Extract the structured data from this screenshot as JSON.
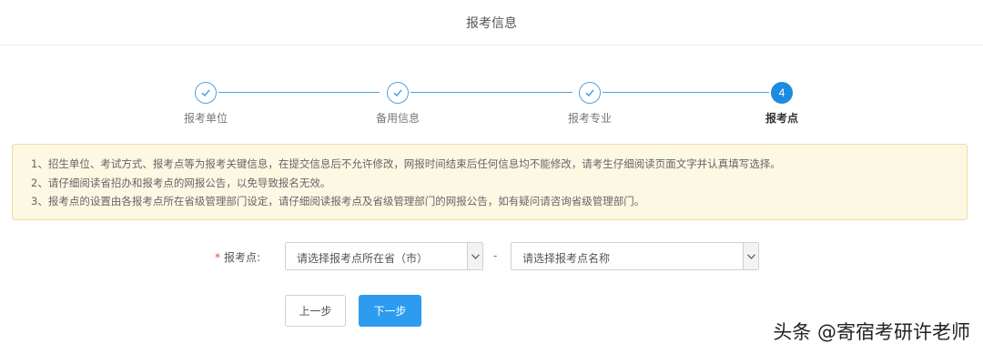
{
  "header": {
    "title": "报考信息"
  },
  "steps": [
    {
      "label": "报考单位",
      "done": true
    },
    {
      "label": "备用信息",
      "done": true
    },
    {
      "label": "报考专业",
      "done": true
    },
    {
      "label": "报考点",
      "number": "4",
      "active": true
    }
  ],
  "notice": {
    "lines": [
      "1、招生单位、考试方式、报考点等为报考关键信息，在提交信息后不允许修改，网报时间结束后任何信息均不能修改，请考生仔细阅读页面文字并认真填写选择。",
      "2、请仔细阅读省招办和报考点的网报公告，以免导致报名无效。",
      "3、报考点的设置由各报考点所在省级管理部门设定，请仔细阅读报考点及省级管理部门的网报公告，如有疑问请咨询省级管理部门。"
    ]
  },
  "form": {
    "required_mark": "*",
    "label": "报考点:",
    "province_select": "请选择报考点所在省（市）",
    "separator": "-",
    "site_select": "请选择报考点名称"
  },
  "buttons": {
    "prev": "上一步",
    "next": "下一步"
  },
  "watermark": "头条 @寄宿考研许老师",
  "colors": {
    "primary": "#2d9cef",
    "step": "#4fa3e0",
    "notice_bg": "#fcf8e3",
    "notice_border": "#f5d9a5",
    "required": "#e74c3c"
  }
}
